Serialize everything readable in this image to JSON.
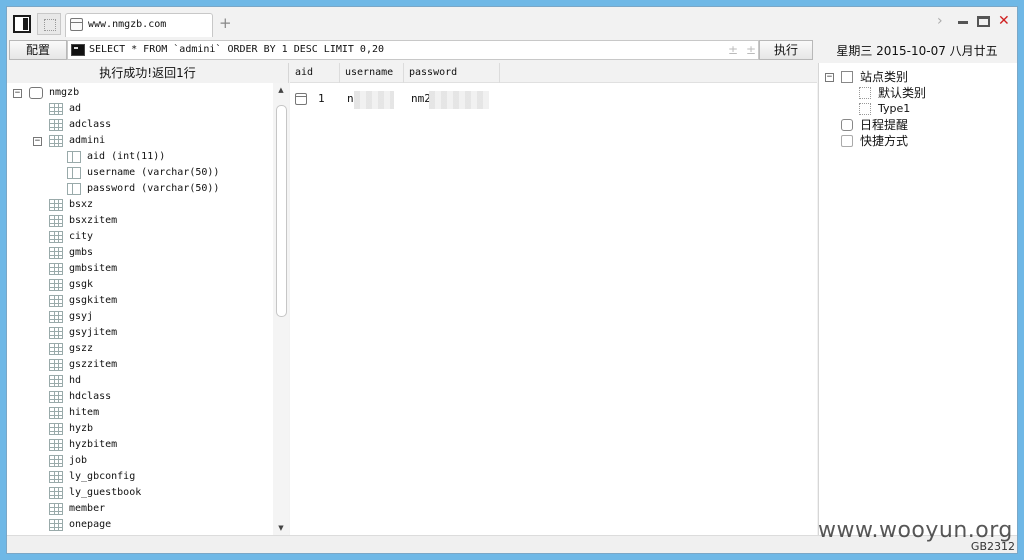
{
  "tab": {
    "title": "www.nmgzb.com"
  },
  "toolbar": {
    "config_label": "配置",
    "sql": "SELECT * FROM `admini` ORDER BY 1 DESC LIMIT 0,20",
    "execute_label": "执行",
    "date": "星期三  2015-10-07  八月廿五"
  },
  "left": {
    "status": "执行成功!返回1行",
    "database": "nmgzb",
    "tables_before": [
      "ad",
      "adclass"
    ],
    "open_table": "admini",
    "columns": [
      "aid (int(11))",
      "username (varchar(50))",
      "password (varchar(50))"
    ],
    "tables_after": [
      "bsxz",
      "bsxzitem",
      "city",
      "gmbs",
      "gmbsitem",
      "gsgk",
      "gsgkitem",
      "gsyj",
      "gsyjitem",
      "gszz",
      "gszzitem",
      "hd",
      "hdclass",
      "hitem",
      "hyzb",
      "hyzbitem",
      "job",
      "ly_gbconfig",
      "ly_guestbook",
      "member",
      "onepage"
    ]
  },
  "grid": {
    "headers": [
      "aid",
      "username",
      "password"
    ],
    "rows": [
      {
        "aid": "1",
        "username": "n",
        "password": "nm2"
      }
    ]
  },
  "right": {
    "root": "站点类别",
    "children": [
      "默认类别",
      "Type1"
    ],
    "schedule": "日程提醒",
    "shortcuts": "快捷方式"
  },
  "statusbar": {
    "encoding": "GB2312"
  },
  "watermark": "www.wooyun.org"
}
